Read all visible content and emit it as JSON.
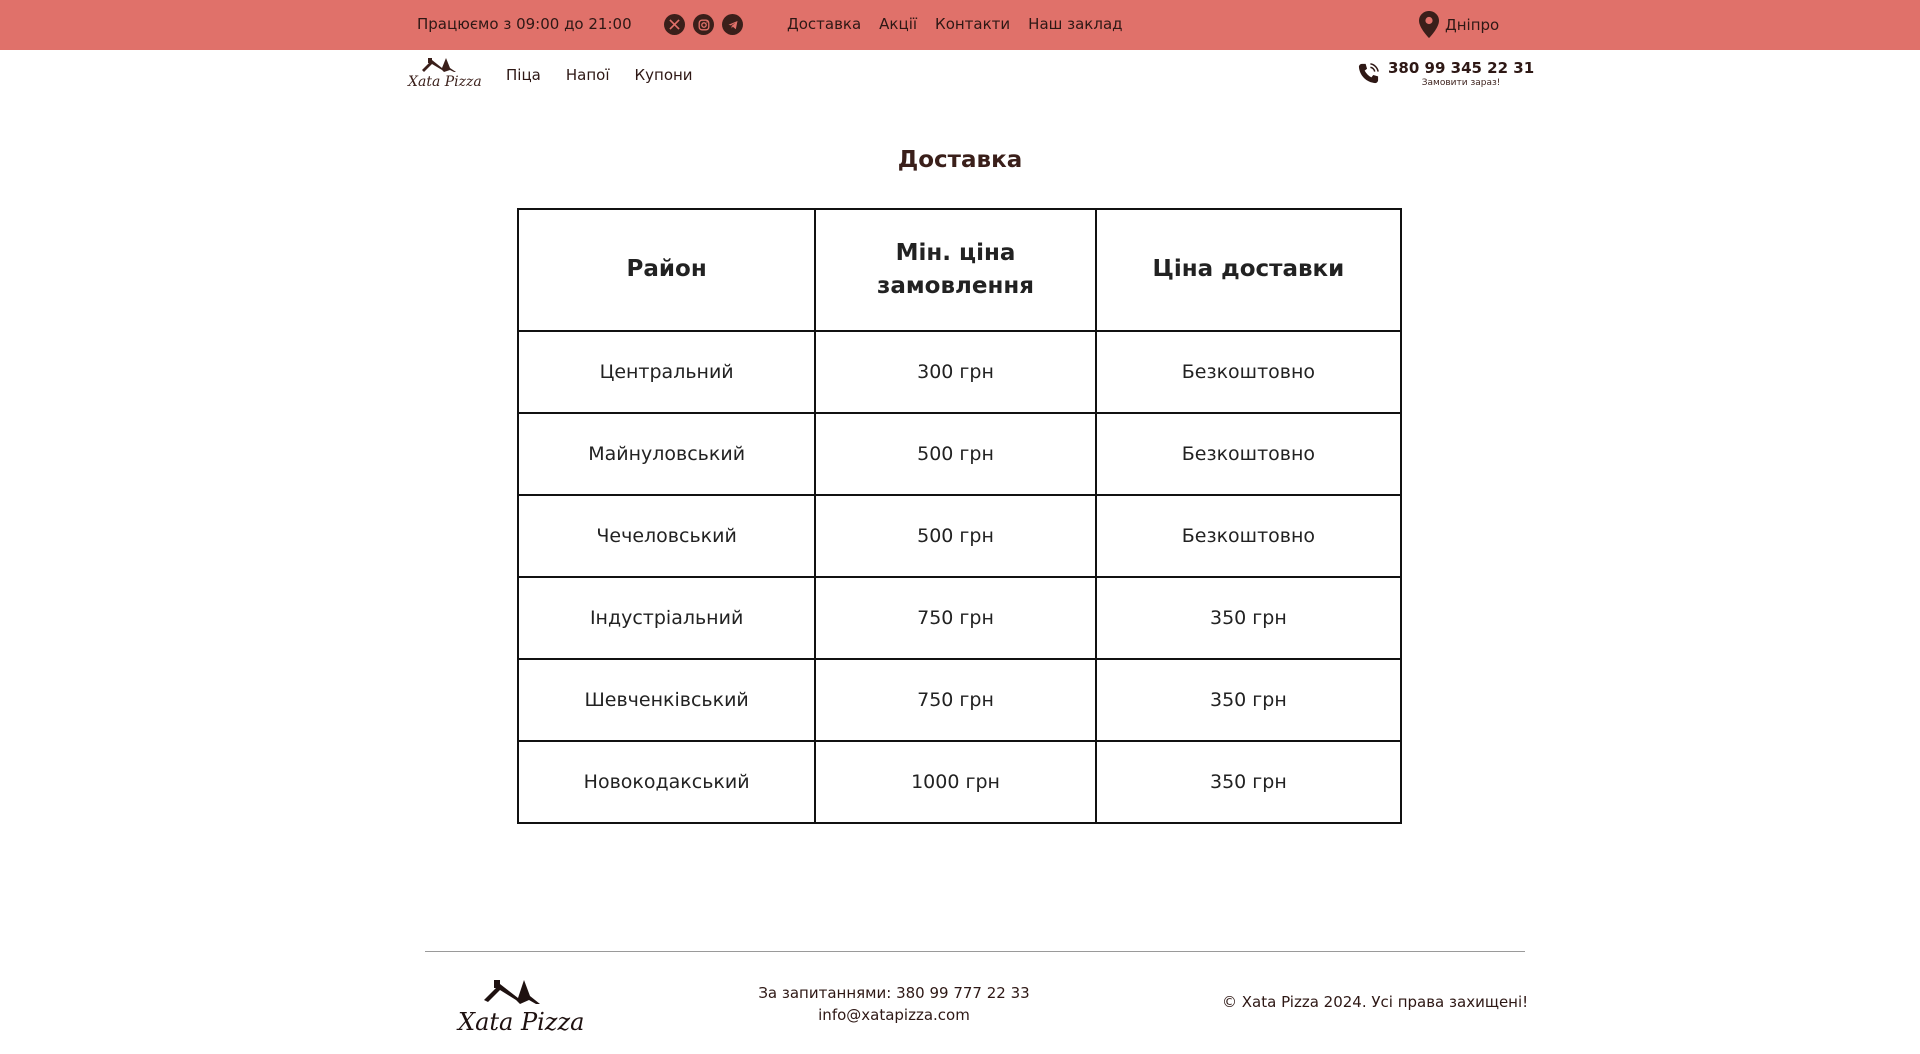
{
  "topbar": {
    "hours": "Працюємо з 09:00 до 21:00",
    "socials": [
      "x-icon",
      "instagram-icon",
      "telegram-icon"
    ],
    "nav": [
      "Доставка",
      "Акції",
      "Контакти",
      "Наш заклад"
    ],
    "city": "Дніпро",
    "bg_color": "#e0716a"
  },
  "header": {
    "logo_text": "Xata Pizza",
    "nav": [
      "Піца",
      "Напої",
      "Купони"
    ],
    "phone": "380 99 345 22 31",
    "phone_sub": "Замовити зараз!"
  },
  "main": {
    "title": "Доставка",
    "table": {
      "headers": [
        "Район",
        "Мін. ціна замовлення",
        "Ціна доставки"
      ],
      "rows": [
        [
          "Центральний",
          "300 грн",
          "Безкоштовно"
        ],
        [
          "Майнуловський",
          "500 грн",
          "Безкоштовно"
        ],
        [
          "Чечеловський",
          "500 грн",
          "Безкоштовно"
        ],
        [
          "Індустріальний",
          "750 грн",
          "350 грн"
        ],
        [
          "Шевченківський",
          "750 грн",
          "350 грн"
        ],
        [
          "Новокодакський",
          "1000 грн",
          "350 грн"
        ]
      ]
    }
  },
  "footer": {
    "logo_text": "Xata Pizza",
    "questions": "За запитаннями: 380 99 777 22 33",
    "email": "info@xatapizza.com",
    "copyright": "© Xata Pizza 2024. Усі права захищені!"
  }
}
